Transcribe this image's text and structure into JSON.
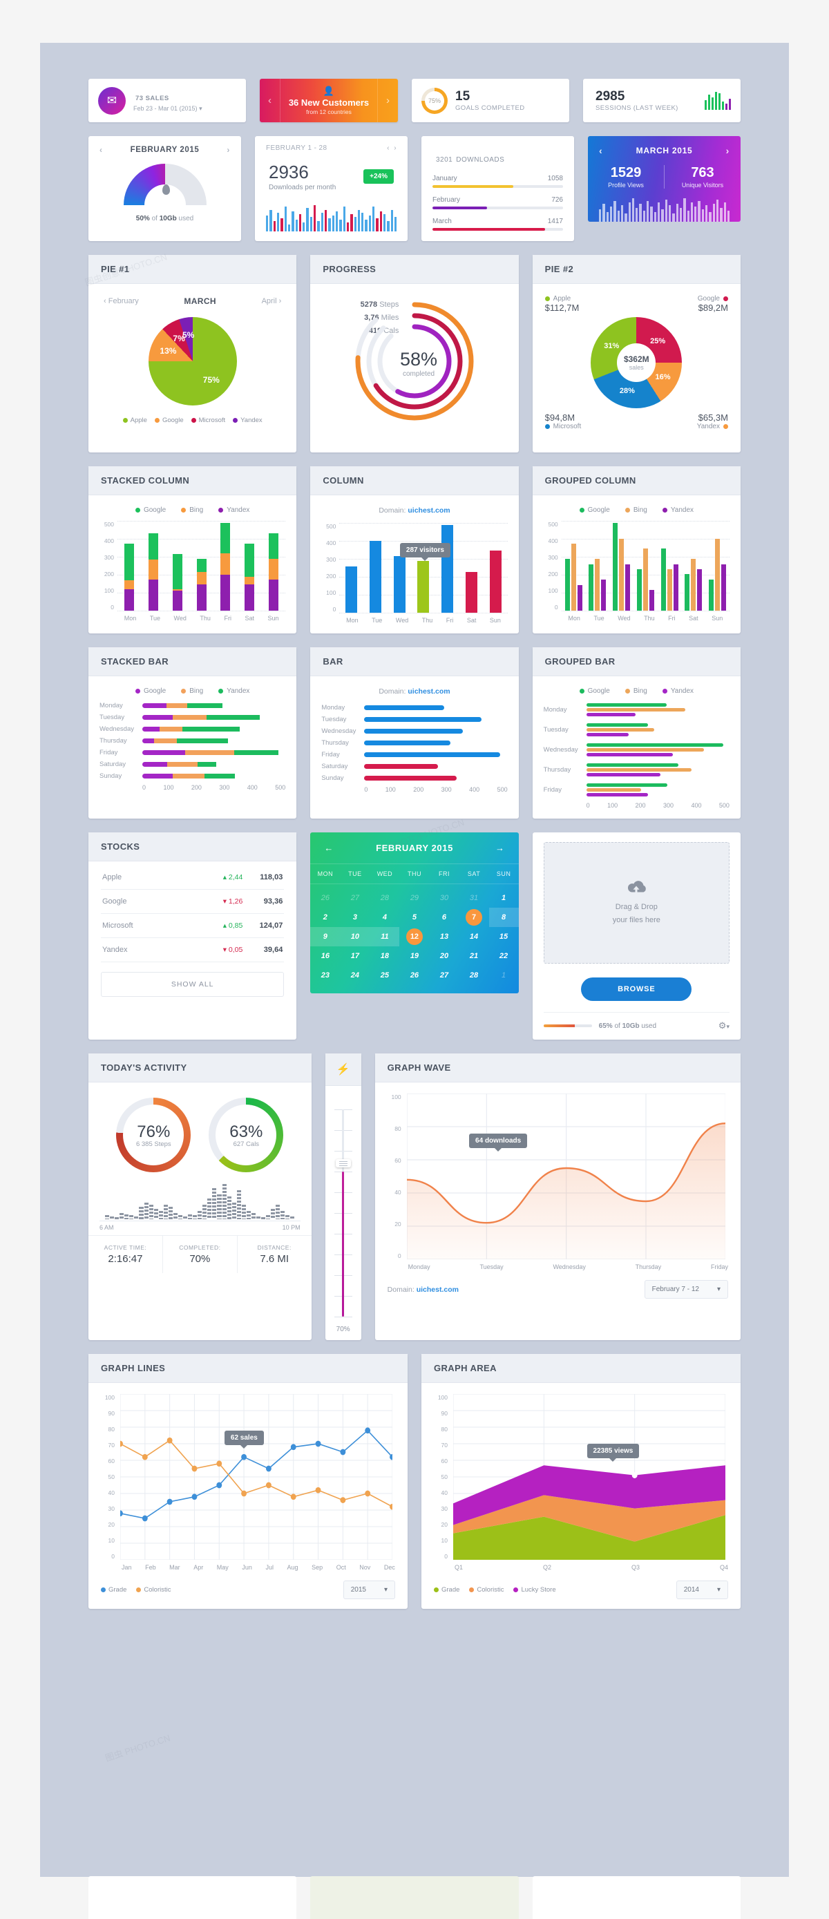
{
  "tiles": {
    "sales": {
      "value": "73",
      "unit": "SALES",
      "period": "Feb 23 - Mar 01 (2015)",
      "caret": "▾",
      "icon": "sales-badge-icon"
    },
    "customers": {
      "value": "36 New Customers",
      "sub": "from 12 countries",
      "prev": "‹",
      "next": "›",
      "icon": "add-user-icon"
    },
    "goals": {
      "percent": "75%",
      "value": "15",
      "label": "GOALS COMPLETED"
    },
    "sessions": {
      "value": "2985",
      "label": "SESSIONS (LAST WEEK)",
      "spark": [
        14,
        22,
        18,
        26,
        24,
        12,
        9,
        16
      ]
    }
  },
  "storage": {
    "title": "FEBRUARY 2015",
    "prev": "‹",
    "next": "›",
    "caption_pct": "50%",
    "caption_mid": " of ",
    "caption_size": "10Gb",
    "caption_tail": " used",
    "used_percent": 50
  },
  "downloads_month": {
    "title": "FEBRUARY 1 - 28",
    "prev": "‹",
    "next": "›",
    "value": "2936",
    "label": "Downloads per month",
    "badge": "+24%",
    "bars": [
      22,
      30,
      14,
      26,
      18,
      34,
      10,
      28,
      16,
      24,
      12,
      32,
      20,
      36,
      14,
      26,
      30,
      18,
      22,
      28,
      16,
      34,
      12,
      24,
      20,
      30,
      26,
      16,
      22,
      34,
      18,
      28,
      24,
      14,
      30,
      20
    ]
  },
  "downloads_total": {
    "value": "3201",
    "label": "DOWNLOADS",
    "rows": [
      {
        "name": "January",
        "value": "1058",
        "percent": 62,
        "color": "#f2c230"
      },
      {
        "name": "February",
        "value": "726",
        "percent": 42,
        "color": "#7b1fb5"
      },
      {
        "name": "March",
        "value": "1417",
        "percent": 86,
        "color": "#d81b4a"
      }
    ]
  },
  "profile": {
    "title": "MARCH 2015",
    "prev": "‹",
    "next": "›",
    "stats": [
      {
        "value": "1529",
        "label": "Profile Views"
      },
      {
        "value": "763",
        "label": "Unique Visitors"
      }
    ],
    "bars": [
      18,
      26,
      14,
      22,
      30,
      16,
      24,
      12,
      28,
      34,
      20,
      26,
      16,
      30,
      22,
      14,
      28,
      18,
      32,
      24,
      12,
      26,
      20,
      34,
      16,
      28,
      22,
      30,
      18,
      24,
      14,
      26,
      32,
      20,
      28,
      16
    ]
  },
  "pie1": {
    "title": "PIE #1",
    "nav": {
      "prev_label": "February",
      "current": "MARCH",
      "next_label": "April",
      "prev": "‹",
      "next": "›"
    },
    "legend": [
      {
        "label": "Apple",
        "color": "#8ec320"
      },
      {
        "label": "Google",
        "color": "#f79a3e"
      },
      {
        "label": "Microsoft",
        "color": "#cc1348"
      },
      {
        "label": "Yandex",
        "color": "#7b1fb5"
      }
    ],
    "slices": [
      {
        "label": "75%",
        "value": 75,
        "color": "#8ec320"
      },
      {
        "label": "13%",
        "value": 13,
        "color": "#f79a3e"
      },
      {
        "label": "7%",
        "value": 7,
        "color": "#cc1348"
      },
      {
        "label": "5%",
        "value": 5,
        "color": "#7b1fb5"
      }
    ]
  },
  "progress": {
    "title": "PROGRESS",
    "rows": [
      {
        "value": "5278",
        "label": "Steps",
        "color": "#f08a2c",
        "percent": 76
      },
      {
        "value": "3,76",
        "label": "Miles",
        "color": "#c01846",
        "percent": 66
      },
      {
        "value": "419",
        "label": "Cals",
        "color": "#a023c0",
        "percent": 58
      }
    ],
    "center_value": "58%",
    "center_label": "completed"
  },
  "pie2": {
    "title": "PIE #2",
    "corners": [
      {
        "label": "Apple",
        "value": "$112,7M",
        "color": "#8ec320"
      },
      {
        "label": "Google",
        "value": "$89,2M",
        "color": "#d11a4e"
      },
      {
        "label": "Microsoft",
        "value": "$94,8M",
        "color": "#1583cc"
      },
      {
        "label": "Yandex",
        "value": "$65,3M",
        "color": "#f79a3e"
      }
    ],
    "center_value": "$362M",
    "center_label": "sales",
    "slices": [
      {
        "label": "25%",
        "value": 25,
        "color": "#d11a4e"
      },
      {
        "label": "16%",
        "value": 16,
        "color": "#f79a3e"
      },
      {
        "label": "28%",
        "value": 28,
        "color": "#1583cc"
      },
      {
        "label": "31%",
        "value": 31,
        "color": "#8ec320"
      }
    ]
  },
  "chart_data": [
    {
      "type": "bar",
      "title": "STACKED COLUMN",
      "stacked": true,
      "categories": [
        "Mon",
        "Tue",
        "Wed",
        "Thu",
        "Fri",
        "Sat",
        "Sun"
      ],
      "yticks": [
        "500",
        "400",
        "300",
        "200",
        "100",
        "0"
      ],
      "ylim": [
        0,
        500
      ],
      "series": [
        {
          "name": "Yandex",
          "color": "#8e1fae",
          "values": [
            120,
            175,
            110,
            145,
            200,
            145,
            175
          ]
        },
        {
          "name": "Bing",
          "color": "#f79a3e",
          "values": [
            50,
            110,
            10,
            70,
            120,
            45,
            115
          ]
        },
        {
          "name": "Google",
          "color": "#1cc15c",
          "values": [
            205,
            145,
            195,
            75,
            170,
            185,
            140
          ]
        }
      ],
      "legend": [
        {
          "label": "Google",
          "color": "#1cc15c"
        },
        {
          "label": "Bing",
          "color": "#f79a3e"
        },
        {
          "label": "Yandex",
          "color": "#8e1fae"
        }
      ]
    },
    {
      "type": "bar",
      "title": "COLUMN",
      "domain_label": "Domain:",
      "domain_value": "uichest.com",
      "categories": [
        "Mon",
        "Tue",
        "Wed",
        "Thu",
        "Fri",
        "Sat",
        "Sun"
      ],
      "yticks": [
        "500",
        "400",
        "300",
        "200",
        "100",
        "0"
      ],
      "ylim": [
        0,
        500
      ],
      "values": [
        258,
        400,
        315,
        287,
        487,
        228,
        345
      ],
      "colors": [
        "#1589e0",
        "#1589e0",
        "#1589e0",
        "#9dc61a",
        "#1589e0",
        "#d51b4c",
        "#d51b4c"
      ],
      "tooltip": "287 visitors"
    },
    {
      "type": "bar",
      "title": "GROUPED COLUMN",
      "grouped": true,
      "categories": [
        "Mon",
        "Tue",
        "Wed",
        "Thu",
        "Fri",
        "Sat",
        "Sun"
      ],
      "yticks": [
        "500",
        "400",
        "300",
        "200",
        "100",
        "0"
      ],
      "ylim": [
        0,
        500
      ],
      "series": [
        {
          "name": "Google",
          "color": "#1cbb5e",
          "values": [
            287,
            258,
            487,
            230,
            345,
            202,
            172
          ]
        },
        {
          "name": "Bing",
          "color": "#eda65a",
          "values": [
            373,
            287,
            400,
            345,
            230,
            287,
            400
          ]
        },
        {
          "name": "Yandex",
          "color": "#8e1fae",
          "values": [
            143,
            172,
            258,
            115,
            258,
            230,
            258
          ]
        }
      ],
      "legend": [
        {
          "label": "Google",
          "color": "#1cbb5e"
        },
        {
          "label": "Bing",
          "color": "#eda65a"
        },
        {
          "label": "Yandex",
          "color": "#8e1fae"
        }
      ]
    },
    {
      "type": "bar",
      "title": "STACKED BAR",
      "orientation": "horizontal",
      "stacked": true,
      "categories": [
        "Monday",
        "Tuesday",
        "Wednesday",
        "Thursday",
        "Friday",
        "Saturday",
        "Sunday"
      ],
      "xticks": [
        "0",
        "100",
        "200",
        "300",
        "400",
        "500"
      ],
      "xlim": [
        0,
        500
      ],
      "series": [
        {
          "name": "Google",
          "color": "#a426c6",
          "values": [
            85,
            105,
            60,
            40,
            150,
            88,
            105
          ]
        },
        {
          "name": "Bing",
          "color": "#f2a15b",
          "values": [
            72,
            120,
            80,
            80,
            170,
            105,
            112
          ]
        },
        {
          "name": "Yandex",
          "color": "#1cbb5e",
          "values": [
            122,
            185,
            200,
            180,
            155,
            65,
            105
          ]
        }
      ],
      "legend": [
        {
          "label": "Google",
          "color": "#a426c6"
        },
        {
          "label": "Bing",
          "color": "#f2a15b"
        },
        {
          "label": "Yandex",
          "color": "#1cbb5e"
        }
      ]
    },
    {
      "type": "bar",
      "title": "BAR",
      "orientation": "horizontal",
      "domain_label": "Domain:",
      "domain_value": "uichest.com",
      "categories": [
        "Monday",
        "Tuesday",
        "Wednesday",
        "Thursday",
        "Friday",
        "Saturday",
        "Sunday"
      ],
      "xticks": [
        "0",
        "100",
        "200",
        "300",
        "400",
        "500"
      ],
      "xlim": [
        0,
        500
      ],
      "values": [
        278,
        410,
        345,
        300,
        475,
        258,
        322
      ],
      "colors": [
        "#1589e0",
        "#1589e0",
        "#1589e0",
        "#1589e0",
        "#1589e0",
        "#d51b4c",
        "#d51b4c"
      ]
    },
    {
      "type": "bar",
      "title": "GROUPED BAR",
      "orientation": "horizontal",
      "grouped": true,
      "categories": [
        "Monday",
        "Tuesday",
        "Wednesday",
        "Thursday",
        "Friday"
      ],
      "xticks": [
        "0",
        "100",
        "200",
        "300",
        "400",
        "500"
      ],
      "xlim": [
        0,
        500
      ],
      "series": [
        {
          "name": "Google",
          "color": "#1cbb5e",
          "values": [
            280,
            215,
            478,
            322,
            282
          ]
        },
        {
          "name": "Bing",
          "color": "#eda65a",
          "values": [
            345,
            237,
            410,
            368,
            192
          ]
        },
        {
          "name": "Yandex",
          "color": "#a426c6",
          "values": [
            172,
            148,
            302,
            260,
            215
          ]
        }
      ],
      "legend": [
        {
          "label": "Google",
          "color": "#1cbb5e"
        },
        {
          "label": "Bing",
          "color": "#eda65a"
        },
        {
          "label": "Yandex",
          "color": "#a426c6"
        }
      ]
    },
    {
      "type": "area",
      "title": "GRAPH WAVE",
      "x": [
        "Monday",
        "Tuesday",
        "Wednesday",
        "Thursday",
        "Friday"
      ],
      "yticks": [
        "100",
        "80",
        "60",
        "40",
        "20",
        "0"
      ],
      "ylim": [
        0,
        100
      ],
      "values": [
        48,
        22,
        55,
        35,
        82
      ],
      "color": "#f0824a",
      "tooltip": "64 downloads",
      "domain_label": "Domain:",
      "domain_value": "uichest.com",
      "range_select": "February 7 - 12"
    },
    {
      "type": "line",
      "title": "GRAPH LINES",
      "x": [
        "Jan",
        "Feb",
        "Mar",
        "Apr",
        "May",
        "Jun",
        "Jul",
        "Aug",
        "Sep",
        "Oct",
        "Nov",
        "Dec"
      ],
      "yticks": [
        "100",
        "90",
        "80",
        "70",
        "60",
        "50",
        "40",
        "30",
        "20",
        "10",
        "0"
      ],
      "ylim": [
        0,
        100
      ],
      "tooltip": "62 sales",
      "year_select": "2015",
      "series": [
        {
          "name": "Grade",
          "color": "#3d8fd8",
          "values": [
            28,
            25,
            35,
            38,
            45,
            62,
            55,
            68,
            70,
            65,
            78,
            62
          ]
        },
        {
          "name": "Coloristic",
          "color": "#f0a350",
          "values": [
            70,
            62,
            72,
            55,
            58,
            40,
            45,
            38,
            42,
            36,
            40,
            32
          ]
        }
      ],
      "legend": [
        {
          "label": "Grade",
          "color": "#3d8fd8"
        },
        {
          "label": "Coloristic",
          "color": "#f0a350"
        }
      ]
    },
    {
      "type": "area",
      "title": "GRAPH AREA",
      "stacked": true,
      "x": [
        "Q1",
        "Q2",
        "Q3",
        "Q4"
      ],
      "yticks": [
        "100",
        "90",
        "80",
        "70",
        "60",
        "50",
        "40",
        "30",
        "20",
        "10",
        "0"
      ],
      "ylim": [
        0,
        100
      ],
      "tooltip": "22385 views",
      "year_select": "2014",
      "series": [
        {
          "name": "Grade",
          "color": "#9cc018",
          "values": [
            16,
            26,
            11,
            27
          ]
        },
        {
          "name": "Coloristic",
          "color": "#f2954f",
          "values": [
            5,
            13,
            20,
            9
          ]
        },
        {
          "name": "Lucky Store",
          "color": "#b521c1",
          "values": [
            13,
            18,
            20,
            21
          ]
        }
      ],
      "legend": [
        {
          "label": "Grade",
          "color": "#9cc018"
        },
        {
          "label": "Coloristic",
          "color": "#f2954f"
        },
        {
          "label": "Lucky Store",
          "color": "#b521c1"
        }
      ]
    }
  ],
  "stocks": {
    "title": "STOCKS",
    "rows": [
      {
        "name": "Apple",
        "change": "2,44",
        "dir": "up",
        "value": "118,03"
      },
      {
        "name": "Google",
        "change": "1,26",
        "dir": "down",
        "value": "93,36"
      },
      {
        "name": "Microsoft",
        "change": "0,85",
        "dir": "up",
        "value": "124,07"
      },
      {
        "name": "Yandex",
        "change": "0,05",
        "dir": "down",
        "value": "39,64"
      }
    ],
    "show_all": "SHOW ALL",
    "up_color": "#23b35a",
    "down_color": "#d4294f"
  },
  "calendar": {
    "title": "FEBRUARY 2015",
    "prev": "←",
    "next": "→",
    "dows": [
      "MON",
      "TUE",
      "WED",
      "THU",
      "FRI",
      "SAT",
      "SUN"
    ],
    "weeks": [
      [
        {
          "d": "26",
          "mut": true
        },
        {
          "d": "27",
          "mut": true
        },
        {
          "d": "28",
          "mut": true
        },
        {
          "d": "29",
          "mut": true
        },
        {
          "d": "30",
          "mut": true
        },
        {
          "d": "31",
          "mut": true
        },
        {
          "d": "1"
        }
      ],
      [
        {
          "d": "2"
        },
        {
          "d": "3"
        },
        {
          "d": "4"
        },
        {
          "d": "5"
        },
        {
          "d": "6"
        },
        {
          "d": "7",
          "sel": true
        },
        {
          "d": "8",
          "hl": true
        }
      ],
      [
        {
          "d": "9",
          "hl": true
        },
        {
          "d": "10",
          "hl": true
        },
        {
          "d": "11",
          "hl": true
        },
        {
          "d": "12",
          "sel": true
        },
        {
          "d": "13"
        },
        {
          "d": "14"
        },
        {
          "d": "15"
        }
      ],
      [
        {
          "d": "16"
        },
        {
          "d": "17"
        },
        {
          "d": "18"
        },
        {
          "d": "19"
        },
        {
          "d": "20"
        },
        {
          "d": "21"
        },
        {
          "d": "22"
        }
      ],
      [
        {
          "d": "23"
        },
        {
          "d": "24"
        },
        {
          "d": "25"
        },
        {
          "d": "26"
        },
        {
          "d": "27"
        },
        {
          "d": "28"
        },
        {
          "d": "1",
          "mut": true
        }
      ]
    ]
  },
  "dropzone": {
    "line1": "Drag & Drop",
    "line2": "your files here",
    "browse": "BROWSE",
    "usage_pct": "65%",
    "usage_mid": " of ",
    "usage_size": "10Gb",
    "usage_tail": " used",
    "gear": "⚙",
    "caret": "▾"
  },
  "activity": {
    "title": "TODAY'S ACTIVITY",
    "rings": [
      {
        "value": "76%",
        "sub": "6 385 Steps",
        "percent": 76,
        "color_from": "#c0392b",
        "color_to": "#f0843e"
      },
      {
        "value": "63%",
        "sub": "627 Cals",
        "percent": 63,
        "color_from": "#9cc018",
        "color_to": "#18b84a"
      }
    ],
    "time_start": "6 AM",
    "time_end": "10 PM",
    "eq": [
      4,
      3,
      2,
      6,
      5,
      4,
      3,
      12,
      16,
      14,
      10,
      8,
      14,
      12,
      6,
      4,
      3,
      5,
      4,
      8,
      14,
      20,
      30,
      24,
      34,
      22,
      16,
      28,
      14,
      8,
      6,
      3,
      2,
      4,
      10,
      14,
      8,
      4,
      3
    ],
    "footer": [
      {
        "label": "ACTIVE TIME:",
        "value": "2:16:47"
      },
      {
        "label": "COMPLETED:",
        "value": "70%"
      },
      {
        "label": "DISTANCE:",
        "value": "7.6 MI"
      }
    ]
  },
  "slider": {
    "icon": "lightning-icon",
    "percent_label": "70%",
    "percent": 70
  }
}
